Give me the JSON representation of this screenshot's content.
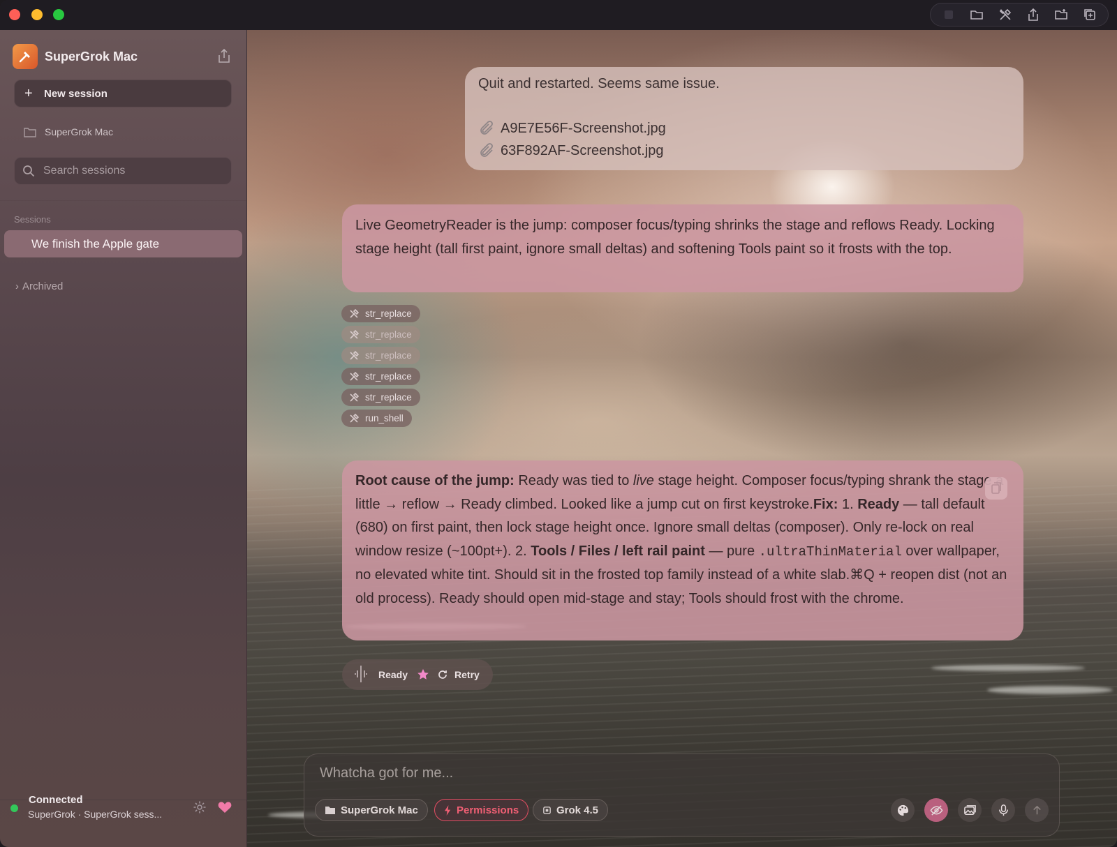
{
  "window": {
    "title": "SuperGrok Mac"
  },
  "toolbar": {
    "icons": [
      "stop-icon",
      "folder-icon",
      "tools-icon",
      "share-icon",
      "folder-add-icon",
      "duplicate-icon"
    ]
  },
  "sidebar": {
    "app_name": "SuperGrok Mac",
    "new_session_label": "New session",
    "project_label": "SuperGrok Mac",
    "search_placeholder": "Search sessions",
    "sessions_heading": "Sessions",
    "sessions": [
      {
        "label": "We finish the Apple gate",
        "selected": true
      }
    ],
    "archived_label": "Archived",
    "status": {
      "title": "Connected",
      "subtitle": "SuperGrok · SuperGrok sess...",
      "color": "#33c75a"
    }
  },
  "chat": {
    "user_message": {
      "text": "Quit and restarted. Seems same issue.",
      "attachments": [
        "A9E7E56F-Screenshot.jpg",
        "63F892AF-Screenshot.jpg"
      ]
    },
    "assistant_message_1": "Live GeometryReader is the jump: composer focus/typing shrinks the stage and reflows Ready. Locking stage height (tall first paint, ignore small deltas) and softening Tools paint so it frosts with the top.",
    "tool_calls": [
      "str_replace",
      "str_replace",
      "str_replace",
      "str_replace",
      "str_replace",
      "run_shell"
    ],
    "assistant_message_2": {
      "t1_bold": "Root cause of the jump:",
      "t2": " Ready was tied to ",
      "t3_italic": "live",
      "t4": " stage height. Composer focus/typing shrank the stage a little → reflow → Ready climbed. Looked like a jump cut on first keystroke.",
      "t5_bold": "Fix:",
      "t6": " 1. ",
      "t7_bold": "Ready",
      "t8": " — tall default (680) on first paint, then lock stage height once. Ignore small deltas (composer). Only re-lock on real window resize (~100pt+). 2. ",
      "t9_bold": "Tools / Files / left rail paint",
      "t10": " — pure ",
      "t11_code": ".ultraThinMaterial",
      "t12": " over wallpaper, no elevated white tint. Should sit in the frosted top family instead of a white slab.⌘Q + reopen dist (not an old process). Ready should open mid-stage and stay; Tools should frost with the chrome."
    },
    "status_pill": {
      "ready_label": "Ready",
      "retry_label": "Retry",
      "star_color": "#f289c8"
    }
  },
  "composer": {
    "placeholder": "Whatcha got for me...",
    "chips": {
      "project": "SuperGrok Mac",
      "permissions": "Permissions",
      "model": "Grok 4.5"
    },
    "permissions_color": "#e44e63"
  }
}
